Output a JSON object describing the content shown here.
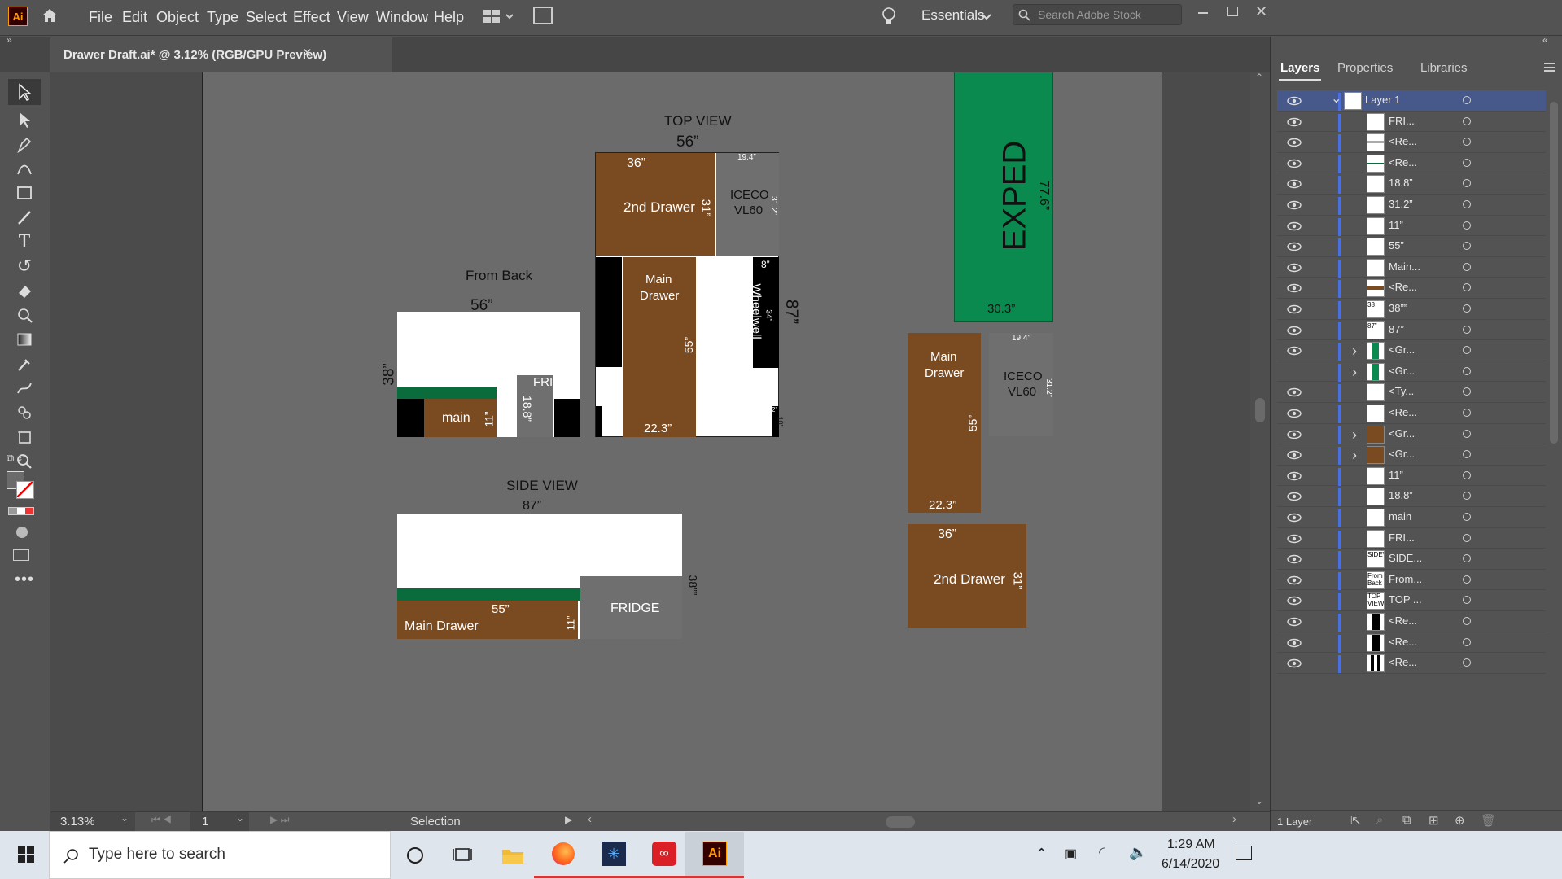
{
  "app": {
    "logo": "Ai",
    "menus": [
      "File",
      "Edit",
      "Object",
      "Type",
      "Select",
      "Effect",
      "View",
      "Window",
      "Help"
    ],
    "workspace": "Essentials",
    "search_placeholder": "Search Adobe Stock"
  },
  "document": {
    "tab_title": "Drawer Draft.ai* @ 3.12% (RGB/GPU Preview)",
    "close": "×"
  },
  "canvas": {
    "top_view_title": "TOP VIEW",
    "top_width": "56”",
    "second_drawer_w": "36”",
    "second_drawer": "2nd Drawer",
    "second_drawer_d": "31”",
    "iceco_w": "19.4”",
    "iceco_line1": "ICECO",
    "iceco_line2": "VL60",
    "iceco_d": "31.2”",
    "main_line1": "Main",
    "main_line2": "Drawer",
    "main_len": "55”",
    "main_w": "22.3”",
    "wheel_w": "8”",
    "wheelwell": "Wheelwell",
    "wheel_len": "34”",
    "len_87": "87”",
    "gap_2": "2”",
    "gap_10": "10”",
    "from_back_title": "From Back",
    "back_width": "56”",
    "back_height": "38”",
    "fridge": "FRIDGE",
    "fridge_h": "18.8”",
    "main_lower": "main",
    "main_h": "11”",
    "side_view_title": "SIDE VIEW",
    "side_len": "87”",
    "side_height": "38””",
    "side_main_len": "55”",
    "side_main": "Main Drawer",
    "side_main_h": "11”",
    "side_fridge": "FRIDGE",
    "exped": "EXPED",
    "exped_len": "77.6”",
    "exped_w": "30.3”",
    "r_main_line1": "Main",
    "r_main_line2": "Drawer",
    "r_main_len": "55”",
    "r_main_w": "22.3”",
    "r_iceco_w": "19.4”",
    "r_iceco_line1": "ICECO",
    "r_iceco_line2": "VL60",
    "r_iceco_d": "31.2”",
    "r_second_w": "36”",
    "r_second": "2nd Drawer",
    "r_second_d": "31”"
  },
  "status": {
    "zoom": "3.13%",
    "artboard": "1",
    "tool": "Selection"
  },
  "panel": {
    "tabs": [
      "Layers",
      "Properties",
      "Libraries"
    ],
    "layer_count": "1 Layer",
    "rows": [
      {
        "name": "Layer 1",
        "thumb": "",
        "expand": "open"
      },
      {
        "name": "FRI...",
        "thumb": ""
      },
      {
        "name": "<Re...",
        "thumb": ""
      },
      {
        "name": "<Re...",
        "thumb": ""
      },
      {
        "name": "18.8”",
        "thumb": ""
      },
      {
        "name": "31.2”",
        "thumb": ""
      },
      {
        "name": "11”",
        "thumb": ""
      },
      {
        "name": "55”",
        "thumb": ""
      },
      {
        "name": "Main...",
        "thumb": ""
      },
      {
        "name": "<Re...",
        "thumb": ""
      },
      {
        "name": "38””",
        "thumb": "38"
      },
      {
        "name": "87”",
        "thumb": "87”"
      },
      {
        "name": "<Gr...",
        "thumb": "",
        "expand": "closed"
      },
      {
        "name": "<Gr...",
        "thumb": "",
        "expand": "closed"
      },
      {
        "name": "<Ty...",
        "thumb": ""
      },
      {
        "name": "<Re...",
        "thumb": ""
      },
      {
        "name": "<Gr...",
        "thumb": "",
        "expand": "closed"
      },
      {
        "name": "<Gr...",
        "thumb": "",
        "expand": "closed"
      },
      {
        "name": "11”",
        "thumb": ""
      },
      {
        "name": "18.8”",
        "thumb": ""
      },
      {
        "name": "main",
        "thumb": ""
      },
      {
        "name": "FRI...",
        "thumb": ""
      },
      {
        "name": "SIDE...",
        "thumb": "SIDEVIEW"
      },
      {
        "name": "From...",
        "thumb": "From Back"
      },
      {
        "name": "TOP ...",
        "thumb": "TOP VIEW"
      },
      {
        "name": "<Re...",
        "thumb": ""
      },
      {
        "name": "<Re...",
        "thumb": ""
      },
      {
        "name": "<Re...",
        "thumb": ""
      }
    ]
  },
  "taskbar": {
    "search_placeholder": "Type here to search",
    "time": "1:29 AM",
    "date": "6/14/2020",
    "ai_label": "Ai"
  },
  "colors": {
    "brown": "#7a4a21",
    "green_exped": "#0b8a4f",
    "green_band": "#0a6b3c",
    "gray_box": "#6f6f6f",
    "layer_blue": "#4a6fe0"
  }
}
